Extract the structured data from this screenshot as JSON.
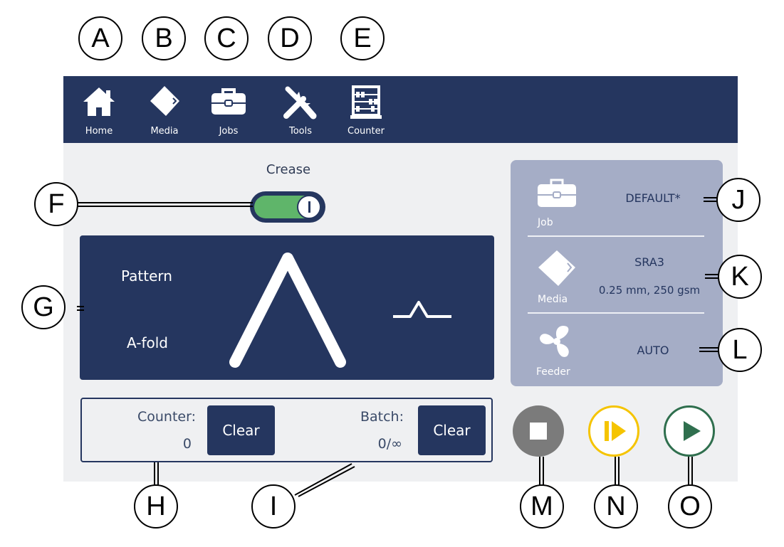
{
  "callouts": {
    "a": "A",
    "b": "B",
    "c": "C",
    "d": "D",
    "e": "E",
    "f": "F",
    "g": "G",
    "h": "H",
    "i": "I",
    "j": "J",
    "k": "K",
    "l": "L",
    "m": "M",
    "n": "N",
    "o": "O"
  },
  "nav": {
    "home": "Home",
    "media": "Media",
    "jobs": "Jobs",
    "tools": "Tools",
    "counter": "Counter"
  },
  "crease": {
    "label": "Crease",
    "enabled": true
  },
  "pattern": {
    "label": "Pattern",
    "value": "A-fold"
  },
  "counter": {
    "counter_label": "Counter:",
    "counter_value": "0",
    "clear_label": "Clear",
    "batch_label": "Batch:",
    "batch_value": "0/∞",
    "batch_clear_label": "Clear"
  },
  "info": {
    "job_label": "Job",
    "job_value": "DEFAULT*",
    "media_label": "Media",
    "media_name": "SRA3",
    "media_detail": "0.25 mm, 250 gsm",
    "feeder_label": "Feeder",
    "feeder_value": "AUTO"
  },
  "colors": {
    "navy": "#25365f",
    "toggle_green": "#5fb56a",
    "stop_gray": "#7b7b7b",
    "pause_yellow": "#f5c400",
    "play_green": "#2f6f4e"
  },
  "icons": [
    "home-icon",
    "media-icon",
    "briefcase-icon",
    "tools-icon",
    "abacus-icon",
    "fan-icon",
    "stop-icon",
    "step-icon",
    "play-icon"
  ]
}
